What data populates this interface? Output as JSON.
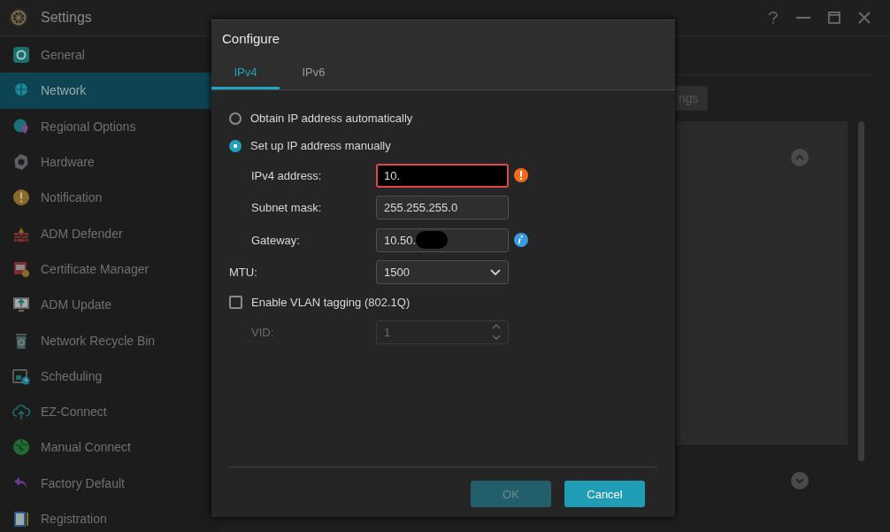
{
  "window": {
    "title": "Settings"
  },
  "sidebar": {
    "items": [
      {
        "label": "General",
        "selected": false
      },
      {
        "label": "Network",
        "selected": true
      },
      {
        "label": "Regional Options",
        "selected": false
      },
      {
        "label": "Hardware",
        "selected": false
      },
      {
        "label": "Notification",
        "selected": false
      },
      {
        "label": "ADM Defender",
        "selected": false
      },
      {
        "label": "Certificate Manager",
        "selected": false
      },
      {
        "label": "ADM Update",
        "selected": false
      },
      {
        "label": "Network Recycle Bin",
        "selected": false
      },
      {
        "label": "Scheduling",
        "selected": false
      },
      {
        "label": "EZ-Connect",
        "selected": false
      },
      {
        "label": "Manual Connect",
        "selected": false
      },
      {
        "label": "Factory Default",
        "selected": false
      },
      {
        "label": "Registration",
        "selected": false
      }
    ]
  },
  "background_button": {
    "label": "ngs"
  },
  "dialog": {
    "title": "Configure",
    "tabs": [
      {
        "label": "IPv4",
        "selected": true
      },
      {
        "label": "IPv6",
        "selected": false
      }
    ],
    "rows": [
      {
        "kind": "radio",
        "label": "Obtain IP address automatically",
        "selected": false
      },
      {
        "kind": "radio",
        "label": "Set up IP address manually",
        "selected": true
      },
      {
        "kind": "text",
        "label": "IPv4 address:",
        "value": "10.",
        "indented": true,
        "invalid": true,
        "masked": true
      },
      {
        "kind": "text",
        "label": "Subnet mask:",
        "value": "255.255.255.0",
        "indented": true
      },
      {
        "kind": "text",
        "label": "Gateway:",
        "value": "10.50.",
        "indented": true,
        "has_info": true,
        "partly_masked": true
      },
      {
        "kind": "select",
        "label": "MTU:",
        "value": "1500",
        "indented": false
      },
      {
        "kind": "checkbox",
        "label": "Enable VLAN tagging (802.1Q)",
        "checked": false
      },
      {
        "kind": "spin",
        "label": "VID:",
        "value": "1",
        "indented": true,
        "disabled": true
      }
    ],
    "buttons": [
      {
        "label": "OK",
        "disabled": true
      },
      {
        "label": "Cancel",
        "disabled": false
      }
    ]
  }
}
